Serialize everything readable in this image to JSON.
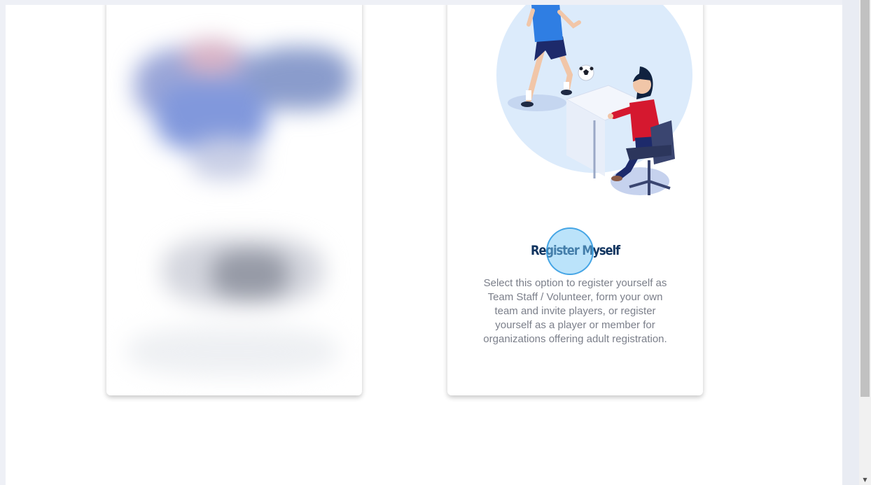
{
  "cards": [
    {
      "id": "obscured-option",
      "title": "",
      "description": ""
    },
    {
      "id": "register-myself",
      "title": "Register Myself",
      "description": "Select this option to register yourself as Team Staff / Volunteer, form your own team and invite players, or register yourself as a player or member for organizations offering adult registration."
    }
  ],
  "illustration": {
    "icon": "soccer-office-illustration",
    "colors": {
      "circle": "#dcebfb",
      "player_shirt": "#2f7ee3",
      "player_shorts": "#1d2a6b",
      "woman_shirt": "#d5182f",
      "chair": "#3a4570"
    }
  },
  "colors": {
    "title": "#10345f",
    "description": "#7b7f8a",
    "click_highlight": "#78c8f5"
  },
  "scrollbar": {
    "down_arrow_icon": "triangle-down-icon",
    "down_arrow_glyph": "▼"
  }
}
